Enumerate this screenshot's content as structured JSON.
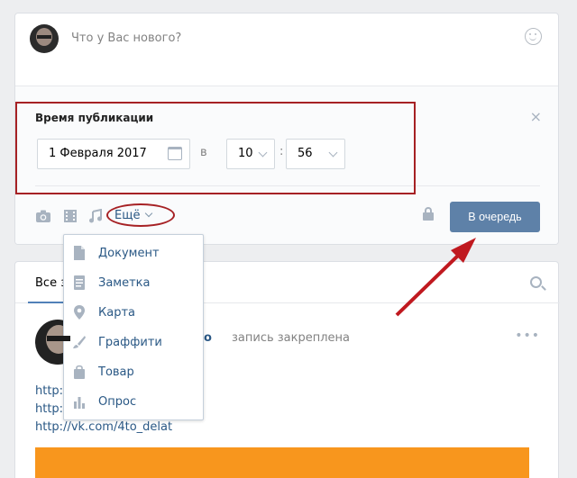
{
  "composer": {
    "placeholder": "Что у Вас нового?"
  },
  "schedule": {
    "title": "Время публикации",
    "date": "1 Февраля 2017",
    "at_label": "в",
    "hour": "10",
    "colon": ":",
    "minute": "56",
    "close": "×"
  },
  "toolbar": {
    "more_label": "Ещё",
    "queue_button": "В очередь"
  },
  "more_menu": {
    "items": [
      {
        "label": "Документ",
        "icon": "document-icon"
      },
      {
        "label": "Заметка",
        "icon": "note-icon"
      },
      {
        "label": "Карта",
        "icon": "map-pin-icon"
      },
      {
        "label": "Граффити",
        "icon": "brush-icon"
      },
      {
        "label": "Товар",
        "icon": "bag-icon"
      },
      {
        "label": "Опрос",
        "icon": "poll-icon"
      }
    ]
  },
  "feed": {
    "tab_all": "Все з",
    "author_tail": "о",
    "pinned_text": "запись закреплена",
    "dots": "•••",
    "links": [
      "http:/",
      "http:/",
      "http://vk.com/4to_delat"
    ]
  },
  "colors": {
    "annotation": "#a62124",
    "button": "#5e81a8",
    "link": "#2a5885",
    "orange": "#f8961d"
  }
}
